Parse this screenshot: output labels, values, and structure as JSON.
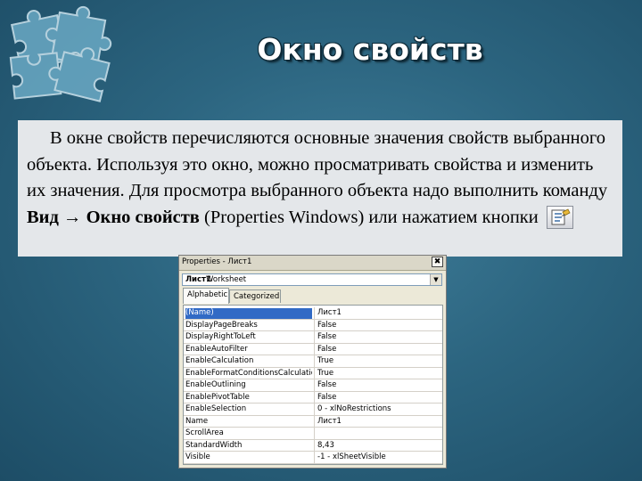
{
  "slide": {
    "title": "Окно свойств",
    "body": {
      "intro": "В окне свойств перечисляются основные значения свойств выбранного объекта.  Используя это окно, можно просматривать свойства и изменить их значения. Для просмотра выбранного объекта надо выполнить команду ",
      "command": "Вид → Окно свойств",
      "outro": " (Properties Windows) или нажатием кнопки"
    },
    "toolbar_icon": "properties-icon"
  },
  "properties_window": {
    "title": "Properties - Лист1",
    "close_label": "✖",
    "object_name": "Лист1",
    "object_type": "Worksheet",
    "tabs": [
      "Alphabetic",
      "Categorized"
    ],
    "rows": [
      {
        "name": "(Name)",
        "value": "Лист1"
      },
      {
        "name": "DisplayPageBreaks",
        "value": "False"
      },
      {
        "name": "DisplayRightToLeft",
        "value": "False"
      },
      {
        "name": "EnableAutoFilter",
        "value": "False"
      },
      {
        "name": "EnableCalculation",
        "value": "True"
      },
      {
        "name": "EnableFormatConditionsCalculation",
        "value": "True"
      },
      {
        "name": "EnableOutlining",
        "value": "False"
      },
      {
        "name": "EnablePivotTable",
        "value": "False"
      },
      {
        "name": "EnableSelection",
        "value": "0 - xlNoRestrictions"
      },
      {
        "name": "Name",
        "value": "Лист1"
      },
      {
        "name": "ScrollArea",
        "value": ""
      },
      {
        "name": "StandardWidth",
        "value": "8,43"
      },
      {
        "name": "Visible",
        "value": "-1 - xlSheetVisible"
      }
    ]
  }
}
